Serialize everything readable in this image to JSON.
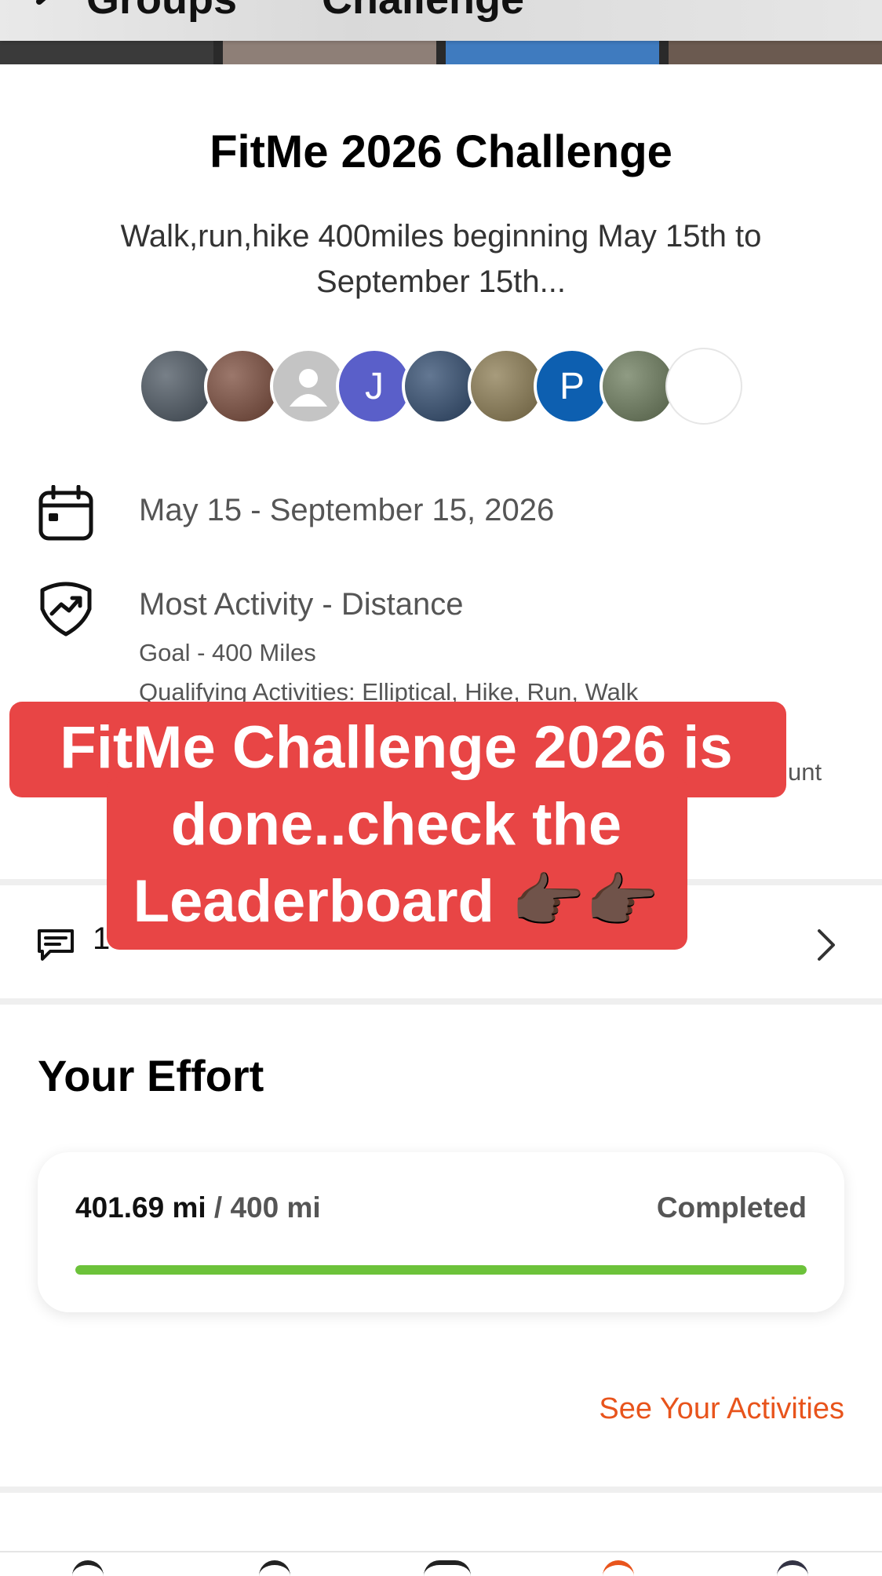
{
  "nav": {
    "back_label": "Groups",
    "title": "Challenge"
  },
  "challenge": {
    "title": "FitMe 2026 Challenge",
    "description_line1": "Walk,run,hike  400miles beginning May 15th to",
    "description_line2": "September 15th..."
  },
  "participants": [
    {
      "type": "photo",
      "color": "#4a5560"
    },
    {
      "type": "photo",
      "color": "#7a4a3a"
    },
    {
      "type": "placeholder",
      "color": "#c4c4c4"
    },
    {
      "type": "initial",
      "initial": "J",
      "color": "#5a5fc9"
    },
    {
      "type": "photo",
      "color": "#2f4a6e"
    },
    {
      "type": "photo",
      "color": "#8a7a50"
    },
    {
      "type": "initial",
      "initial": "P",
      "color": "#0d5fb0"
    },
    {
      "type": "photo",
      "color": "#6a7a5a"
    },
    {
      "type": "blank",
      "color": "#ffffff"
    }
  ],
  "dates": {
    "text": "May 15 - September 15, 2026"
  },
  "activity": {
    "type_text": "Most Activity - Distance",
    "goal_text": "Goal - 400 Miles",
    "qualifying_text": "Qualifying Activities: Elliptical, Hike, Run, Walk",
    "clipped_fragment": "unt"
  },
  "overlay": {
    "line1": "FitMe  Challenge 2026 is",
    "line2": "done..check the",
    "line3": "Leaderboard 👉🏿👉🏿"
  },
  "comments": {
    "label": "14 Comments"
  },
  "effort": {
    "title": "Your Effort",
    "value": "401.69 mi",
    "goal": " / 400 mi",
    "status": "Completed",
    "progress_fraction": 1.0
  },
  "links": {
    "see_activities": "See Your Activities"
  },
  "colors": {
    "accent_orange": "#e8541c",
    "progress_green": "#6cc23a",
    "overlay_red": "#e84545"
  }
}
